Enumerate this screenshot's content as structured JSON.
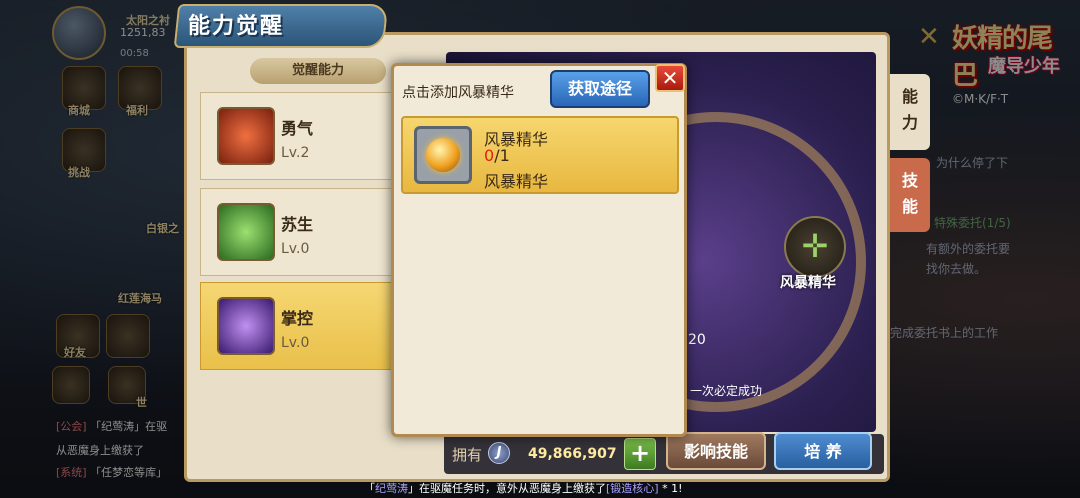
{
  "player": {
    "name": "太阳之衬",
    "number": "1251,83",
    "time": "00:58"
  },
  "left_icons": [
    {
      "label": "商城"
    },
    {
      "label": "福利"
    },
    {
      "label": "挑战"
    }
  ],
  "logo": {
    "line1": "妖精的尾巴",
    "line2": "魔导少年"
  },
  "copyright": "©M·K/F·T",
  "panel": {
    "title": "能力觉醒",
    "subhead": "觉醒能力",
    "abilities": [
      {
        "name": "勇气",
        "level": "Lv.2",
        "selected": false
      },
      {
        "name": "苏生",
        "level": "Lv.0",
        "selected": false
      },
      {
        "name": "掌控",
        "level": "Lv.0",
        "selected": true
      }
    ],
    "tabs": [
      "能力",
      "技能"
    ],
    "slot_label": "风暴精华",
    "num20": "20",
    "success_text": "一次必定成功"
  },
  "bottom": {
    "own_label": "拥有",
    "own_count": "49,866,907",
    "add_symbol": "+",
    "influence_button": "影响技能",
    "train_button": "培 养"
  },
  "side_left": {
    "friend": "好友",
    "world": "世",
    "chat1_tag": "[公会]",
    "chat1": "「纪莺涛」在驱",
    "chat2": "从恶魔身上缴获了",
    "chat3_tag": "[系统]",
    "chat3": "「任梦恋等库」",
    "map_lbl1": "白银之",
    "map_lbl2": "红莲海马"
  },
  "side_right": {
    "line1": "为什么停了下",
    "line2": "特殊委托(1/5)",
    "line3": "有额外的委托要",
    "line4": "找你去做。",
    "line5": "完成委托书上的工作"
  },
  "ticker": {
    "pre": "「",
    "name": "纪莺涛",
    "mid": "」在驱魔任务时，意外从恶魔身上缴获了",
    "item": "[锻造核心]",
    "post": " * 1!"
  },
  "modal": {
    "hint": "点击添加风暴精华",
    "get_button": "获取途径",
    "close": "✕",
    "item_name": "风暴精华",
    "item_have": "0",
    "item_need": "/1",
    "item_source": "风暴精华"
  }
}
